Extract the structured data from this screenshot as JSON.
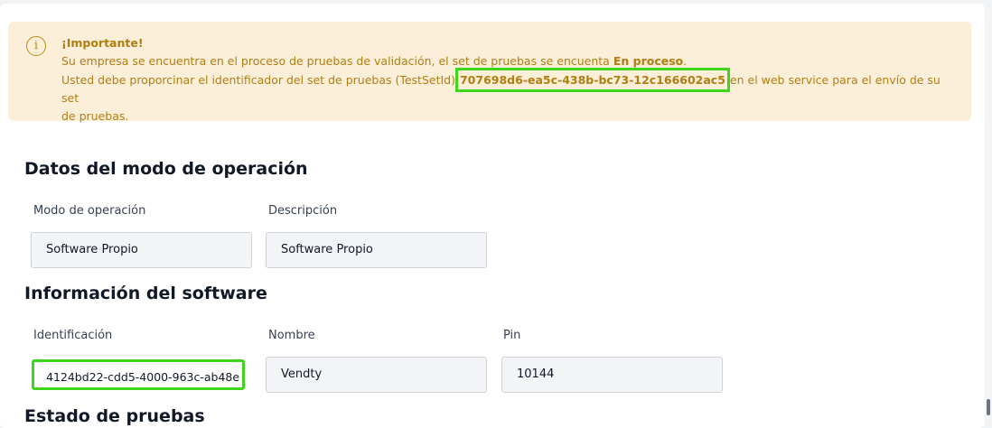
{
  "alert": {
    "title": "¡Importante!",
    "line1_prefix": "Su empresa se encuentra en el proceso de pruebas de validación, el set de pruebas se encuenta",
    "line1_status": "En proceso",
    "line1_suffix": ".",
    "line2_prefix": "Usted debe proporcinar el identificador del set de pruebas (TestSetId)",
    "test_set_id": "707698d6-ea5c-438b-bc73-12c166602ac5",
    "line2_suffix": "en el web service para el envío de su set",
    "line3": "de pruebas.",
    "icon": "info-icon"
  },
  "operation_mode": {
    "title": "Datos del modo de operación",
    "mode_label": "Modo de operación",
    "mode_value": "Software Propio",
    "description_label": "Descripción",
    "description_value": "Software Propio"
  },
  "software_info": {
    "title": "Información del software",
    "id_label": "Identificación",
    "id_value": "4124bd22-cdd5-4000-963c-ab48e",
    "name_label": "Nombre",
    "name_value": "Vendty",
    "pin_label": "Pin",
    "pin_value": "10144"
  },
  "next_section": {
    "title": "Estado de pruebas"
  },
  "colors": {
    "alert_bg": "#fcefd9",
    "alert_text": "#b07d10",
    "highlight": "#3ed61a"
  }
}
